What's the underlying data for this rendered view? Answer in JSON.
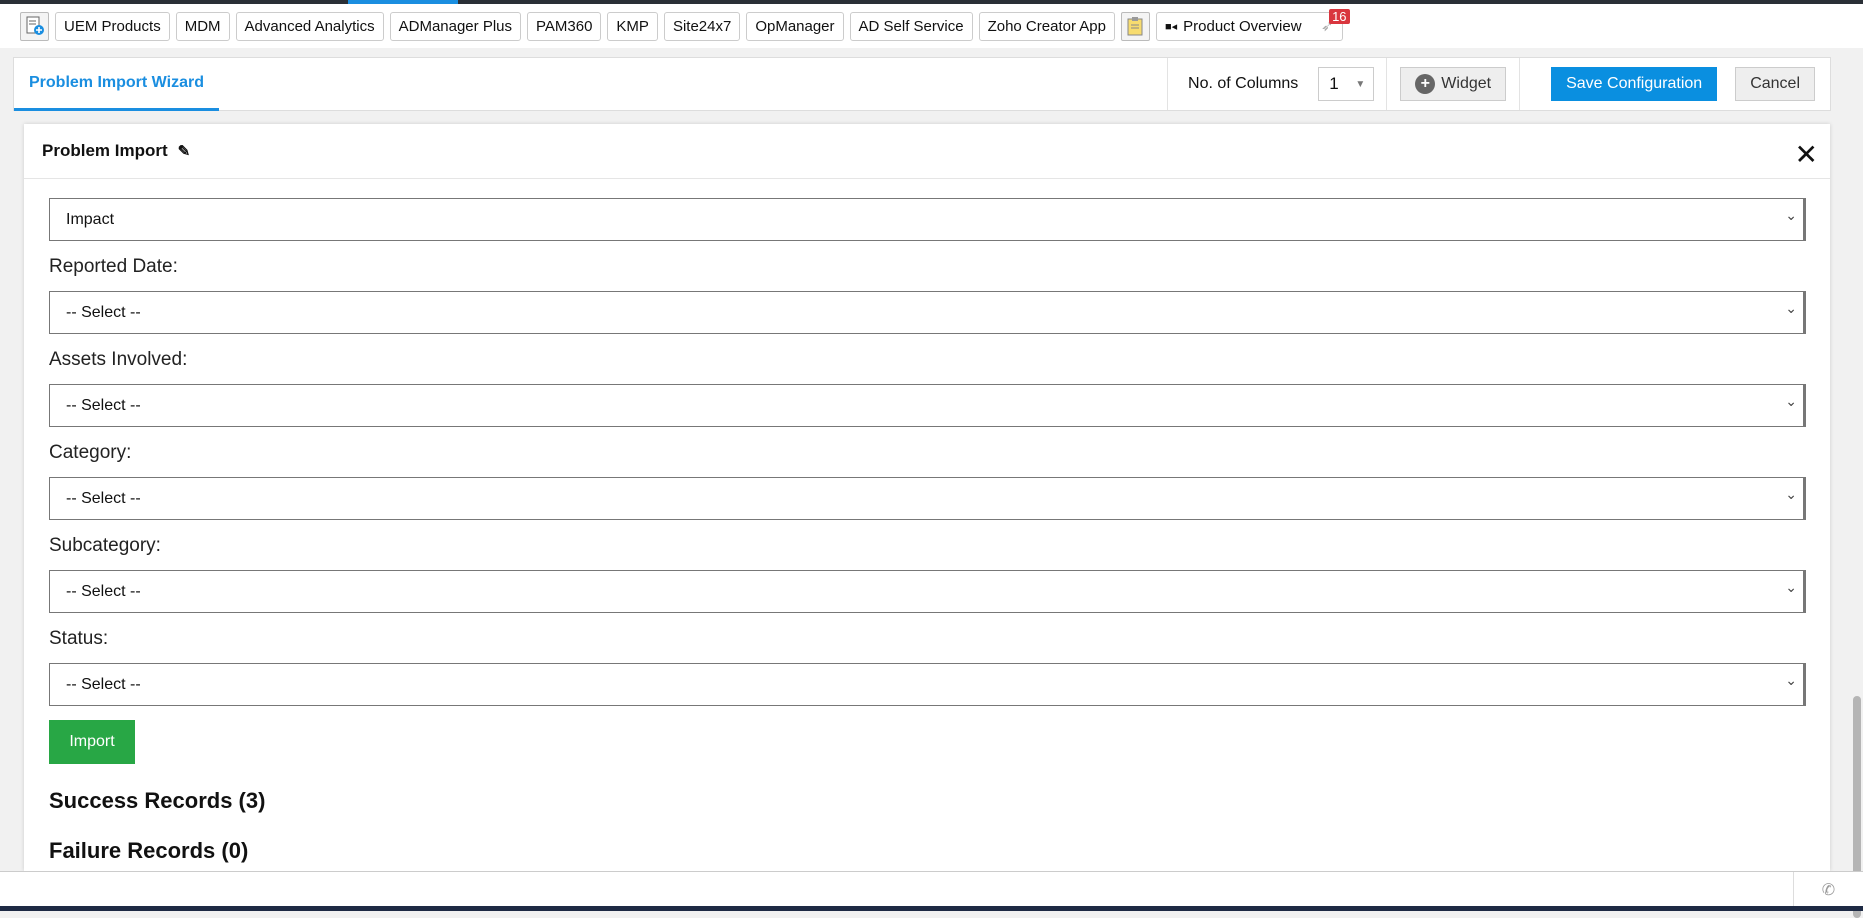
{
  "toolbar": {
    "items": [
      "UEM Products",
      "MDM",
      "Advanced Analytics",
      "ADManager Plus",
      "PAM360",
      "KMP",
      "Site24x7",
      "OpManager",
      "AD Self Service",
      "Zoho Creator App"
    ],
    "product_overview": "Product Overview",
    "notification_count": "16"
  },
  "panel": {
    "tab": "Problem Import Wizard",
    "columns_label": "No. of Columns",
    "columns_value": "1",
    "widget": "Widget",
    "save": "Save Configuration",
    "cancel": "Cancel"
  },
  "modal": {
    "title": "Problem Import",
    "first_select": "Impact",
    "fields": [
      {
        "label": "Reported Date:",
        "value": "-- Select --"
      },
      {
        "label": "Assets Involved:",
        "value": "-- Select --"
      },
      {
        "label": "Category:",
        "value": "-- Select --"
      },
      {
        "label": "Subcategory:",
        "value": "-- Select --"
      },
      {
        "label": "Status:",
        "value": "-- Select --"
      }
    ],
    "import": "Import",
    "success": "Success Records (3)",
    "failure": "Failure Records (0)"
  },
  "colors": {
    "accent": "#1a8ee0",
    "import": "#28a745",
    "badge": "#d9363e"
  }
}
